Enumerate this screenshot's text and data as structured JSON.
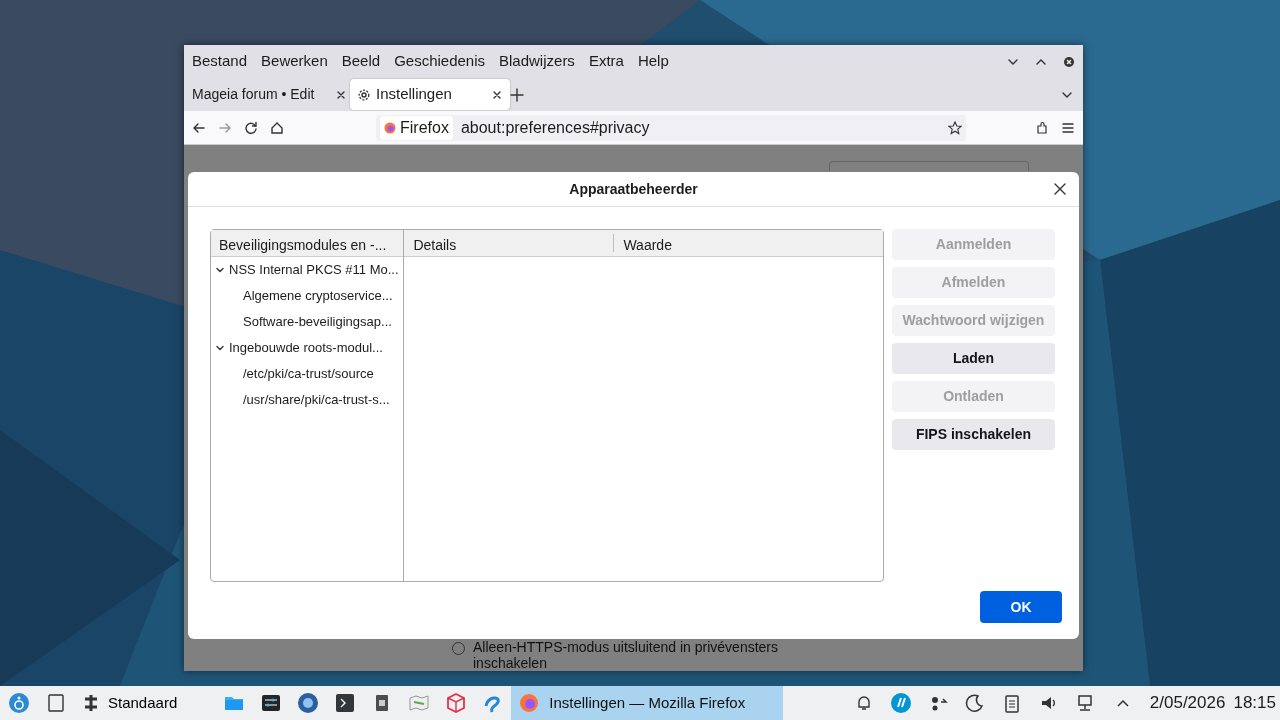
{
  "menu_bar": {
    "items": [
      "Bestand",
      "Bewerken",
      "Beeld",
      "Geschiedenis",
      "Bladwijzers",
      "Extra",
      "Help"
    ]
  },
  "tabs": [
    {
      "label": "Mageia forum • Edit",
      "selected": false,
      "kind": "page"
    },
    {
      "label": "Instellingen",
      "selected": true,
      "kind": "settings"
    }
  ],
  "address_bar": {
    "identity": "Firefox",
    "url": "about:preferences#privacy"
  },
  "background_page": {
    "radio": {
      "label": "Alleen-HTTPS-modus uitsluitend in privévensters inschakelen",
      "checked": false
    }
  },
  "dialog": {
    "title": "Apparaatbeheerder",
    "tree": {
      "column": "Beveiligingsmodules en -...",
      "items": [
        {
          "label": "NSS Internal PKCS #11 Mo...",
          "expanded": true,
          "children": [
            {
              "label": "Algemene cryptoservice..."
            },
            {
              "label": "Software-beveiligingsap..."
            }
          ]
        },
        {
          "label": "Ingebouwde roots-modul...",
          "expanded": true,
          "children": [
            {
              "label": "/etc/pki/ca-trust/source"
            },
            {
              "label": "/usr/share/pki/ca-trust-s..."
            }
          ]
        }
      ]
    },
    "details": {
      "columns": [
        "Details",
        "Waarde"
      ]
    },
    "buttons": [
      {
        "label": "Aanmelden",
        "disabled": true
      },
      {
        "label": "Afmelden",
        "disabled": true
      },
      {
        "label": "Wachtwoord wijzigen",
        "disabled": true
      },
      {
        "label": "Laden",
        "disabled": false
      },
      {
        "label": "Ontladen",
        "disabled": true
      },
      {
        "label": "FIPS inschakelen",
        "disabled": false
      }
    ],
    "ok_button": "OK"
  },
  "taskbar": {
    "launcher": "Standaard",
    "task": {
      "label": "Instellingen — Mozilla Firefox",
      "active": true
    },
    "date": "2/05/2026",
    "time": "18:15"
  }
}
